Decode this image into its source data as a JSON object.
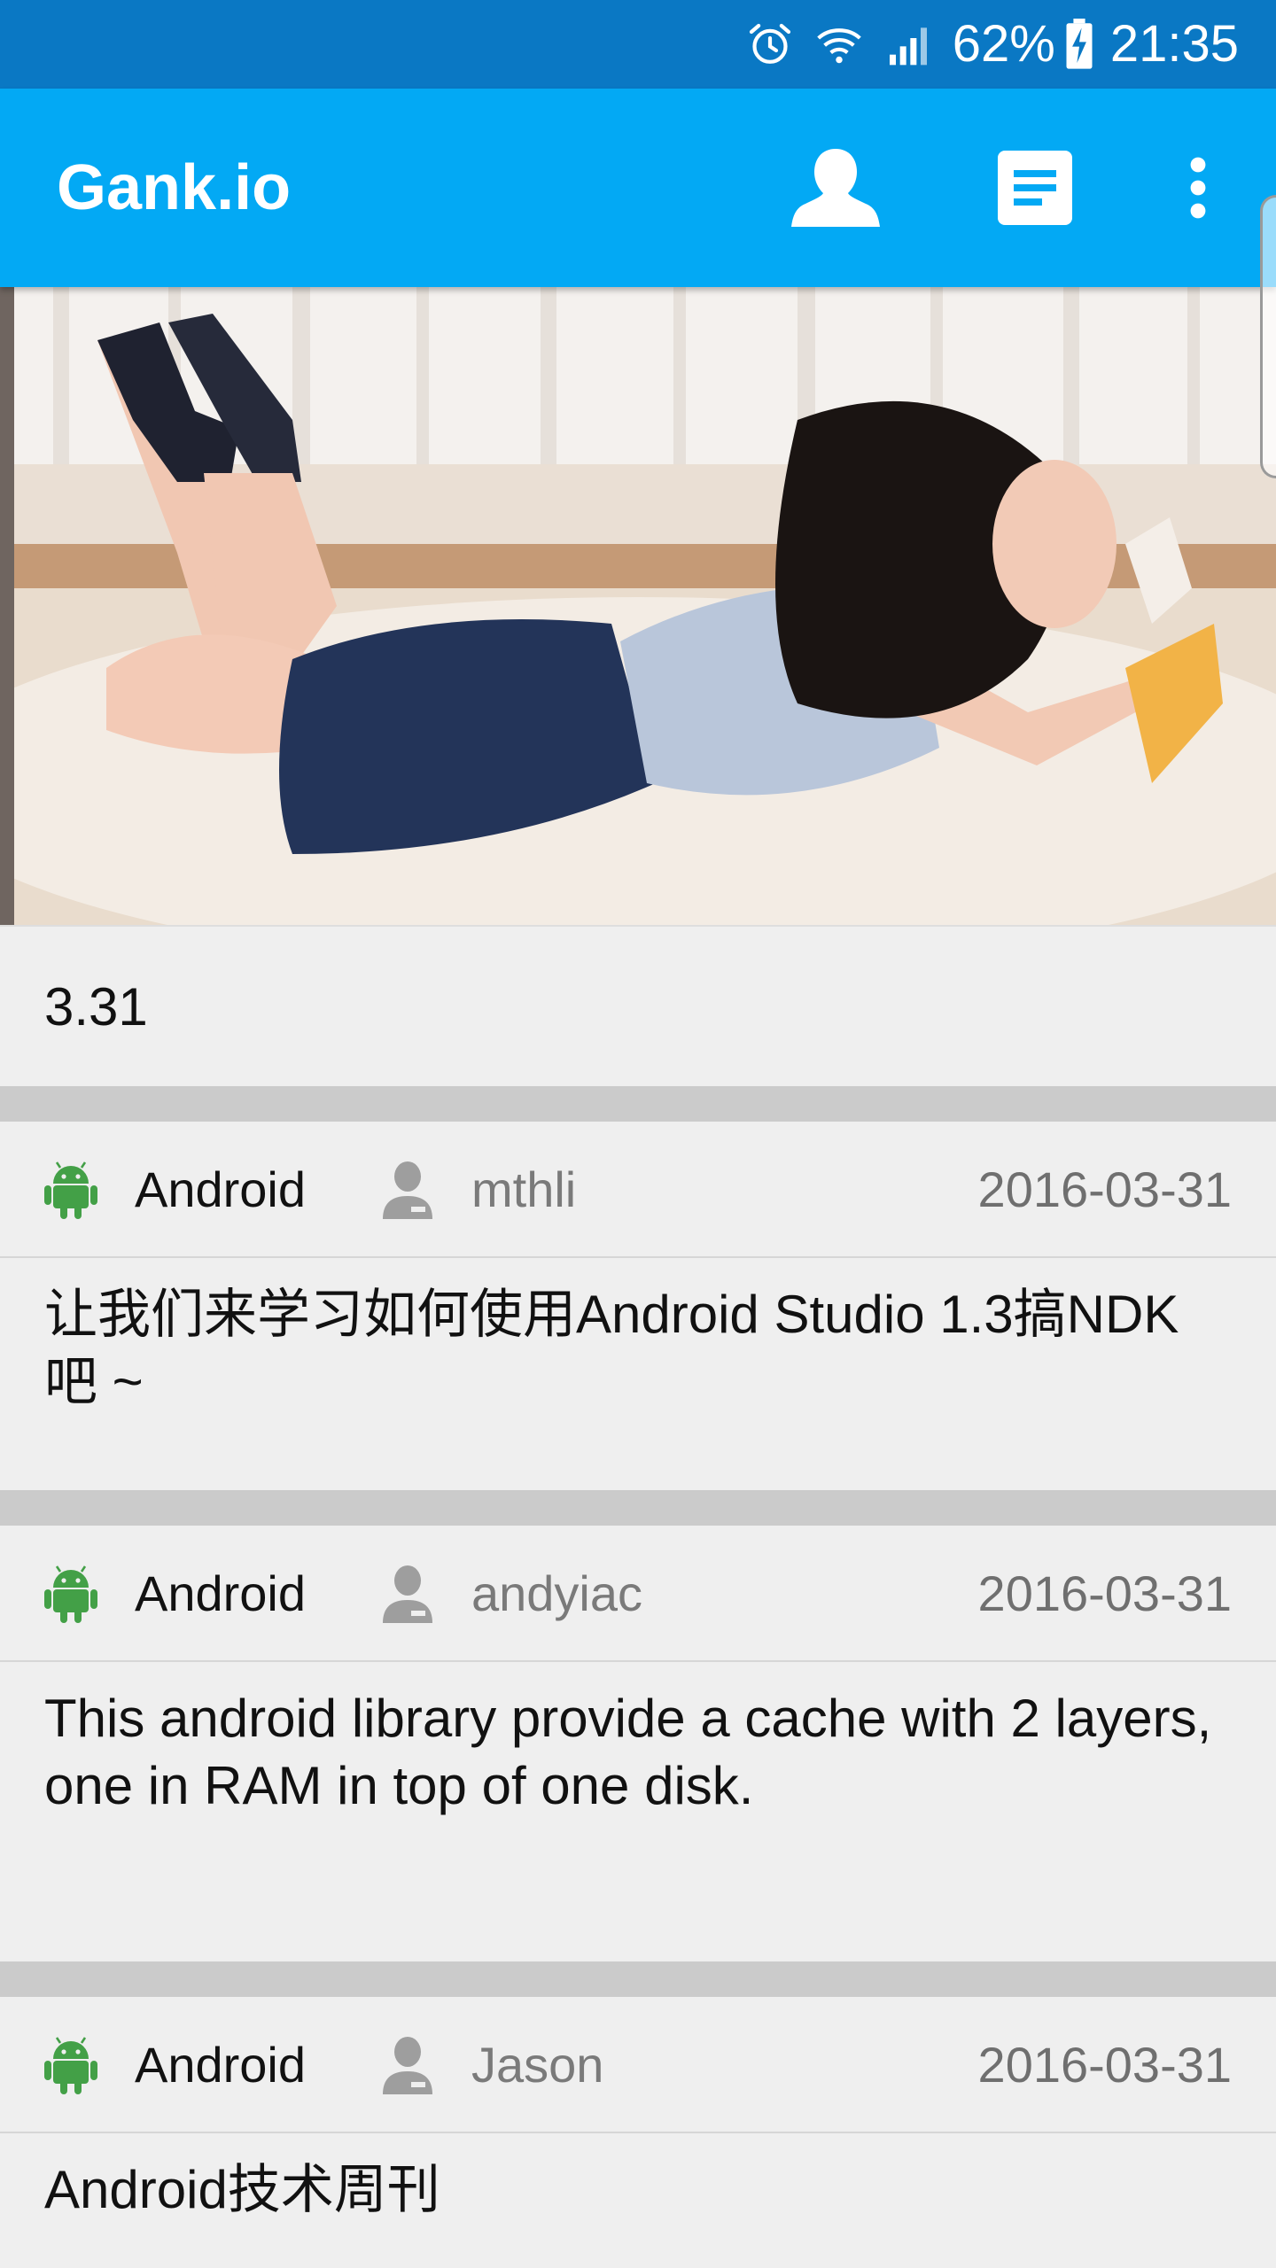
{
  "status_bar": {
    "battery": "62%",
    "time": "21:35",
    "icons": [
      "alarm-icon",
      "wifi-icon",
      "signal-icon",
      "battery-charging-icon"
    ]
  },
  "app_bar": {
    "title": "Gank.io",
    "actions": [
      "person-icon",
      "notes-icon",
      "more-vert-icon"
    ]
  },
  "hero_image": {
    "subject": "photo banner"
  },
  "date_header": "3.31",
  "items": [
    {
      "type": "Android",
      "author": "mthli",
      "date": "2016-03-31",
      "desc": "让我们来学习如何使用Android Studio 1.3搞NDK吧 ~"
    },
    {
      "type": "Android",
      "author": "andyiac",
      "date": "2016-03-31",
      "desc": "This android library provide a cache with 2 layers, one in RAM in top of one disk."
    },
    {
      "type": "Android",
      "author": "Jason",
      "date": "2016-03-31",
      "desc": "Android技术周刊"
    }
  ],
  "colors": {
    "status_bar": "#0a78c4",
    "app_bar": "#03a9f4",
    "android_green": "#43a047",
    "card_bg": "#efefef",
    "divider": "#cbcbcb"
  }
}
